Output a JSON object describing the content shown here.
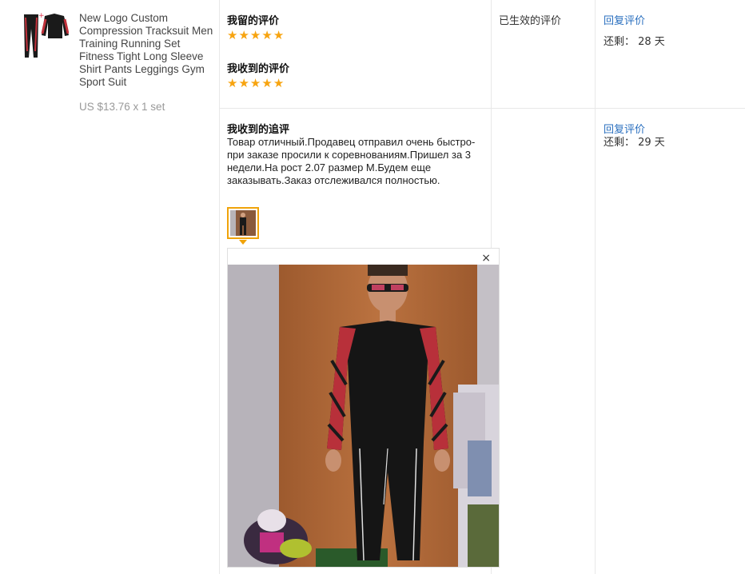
{
  "product": {
    "title": "New Logo Custom Compression Tracksuit Men Training Running Set Fitness Tight Long Sleeve Shirt Pants Leggings Gym Sport Suit",
    "price": "US $13.76 x 1 set"
  },
  "my_review": {
    "label": "我留的评价",
    "rating": 5
  },
  "received_review": {
    "label": "我收到的评价",
    "rating": 5
  },
  "status": "已生效的评价",
  "row1": {
    "reply_link": "回复评价",
    "remaining": "还剩： 28 天"
  },
  "followup": {
    "label": "我收到的追评",
    "text": "Товар отличный.Продавец отправил очень быстро-при заказе просили к соревнованиям.Пришел за 3 недели.На рост 2.07 размер М.Будем еще заказывать.Заказ отслеживался полностью.",
    "reply_link": "回复评价",
    "remaining": "还剩： 29 天"
  },
  "preview": {
    "close": "×"
  },
  "icons": {
    "star": "★",
    "accent": "#f7a410",
    "link_color": "#2a6fbf"
  }
}
